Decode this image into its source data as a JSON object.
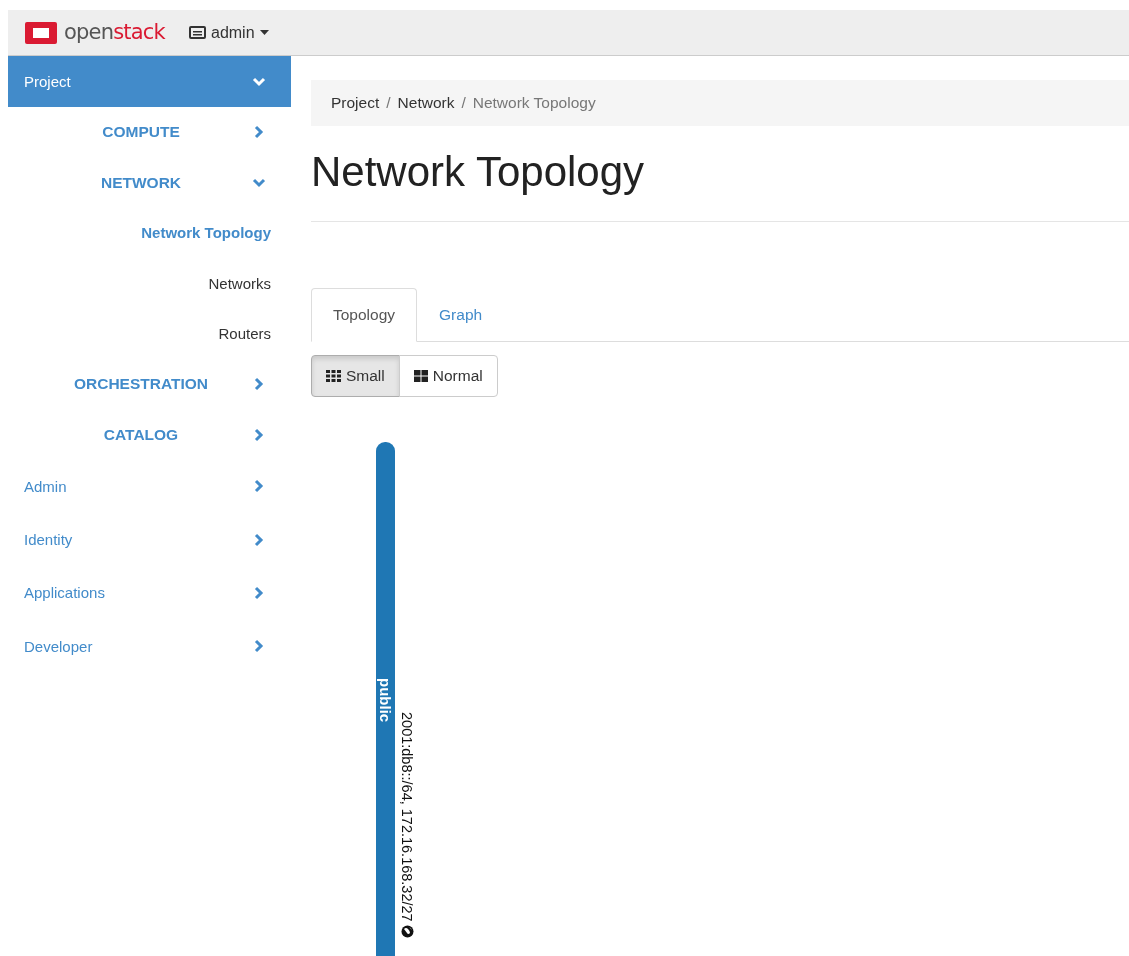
{
  "topbar": {
    "brand_parts": [
      "open",
      "stack"
    ],
    "project_menu": "admin"
  },
  "sidebar": {
    "items": [
      {
        "label": "Project",
        "expanded": true,
        "children": [
          {
            "label": "COMPUTE",
            "expanded": false
          },
          {
            "label": "NETWORK",
            "expanded": true,
            "children": [
              {
                "label": "Network Topology",
                "selected": true
              },
              {
                "label": "Networks",
                "selected": false
              },
              {
                "label": "Routers",
                "selected": false
              }
            ]
          },
          {
            "label": "ORCHESTRATION",
            "expanded": false
          },
          {
            "label": "CATALOG",
            "expanded": false
          }
        ]
      },
      {
        "label": "Admin",
        "expanded": false
      },
      {
        "label": "Identity",
        "expanded": false
      },
      {
        "label": "Applications",
        "expanded": false
      },
      {
        "label": "Developer",
        "expanded": false
      }
    ]
  },
  "breadcrumb": [
    {
      "label": "Project",
      "separator": "/"
    },
    {
      "label": "Network",
      "separator": "/"
    },
    {
      "label": "Network Topology"
    }
  ],
  "page_title": "Network Topology",
  "tabs": [
    {
      "label": "Topology",
      "selected": true
    },
    {
      "label": "Graph",
      "selected": false
    }
  ],
  "size_buttons": [
    {
      "label": "Small",
      "kind": "small",
      "selected": true
    },
    {
      "label": "Normal",
      "kind": "normal",
      "selected": false
    }
  ],
  "networks": [
    {
      "name": "public",
      "subnets": "2001:db8::/64, 172.16.168.32/27",
      "external": true
    }
  ]
}
